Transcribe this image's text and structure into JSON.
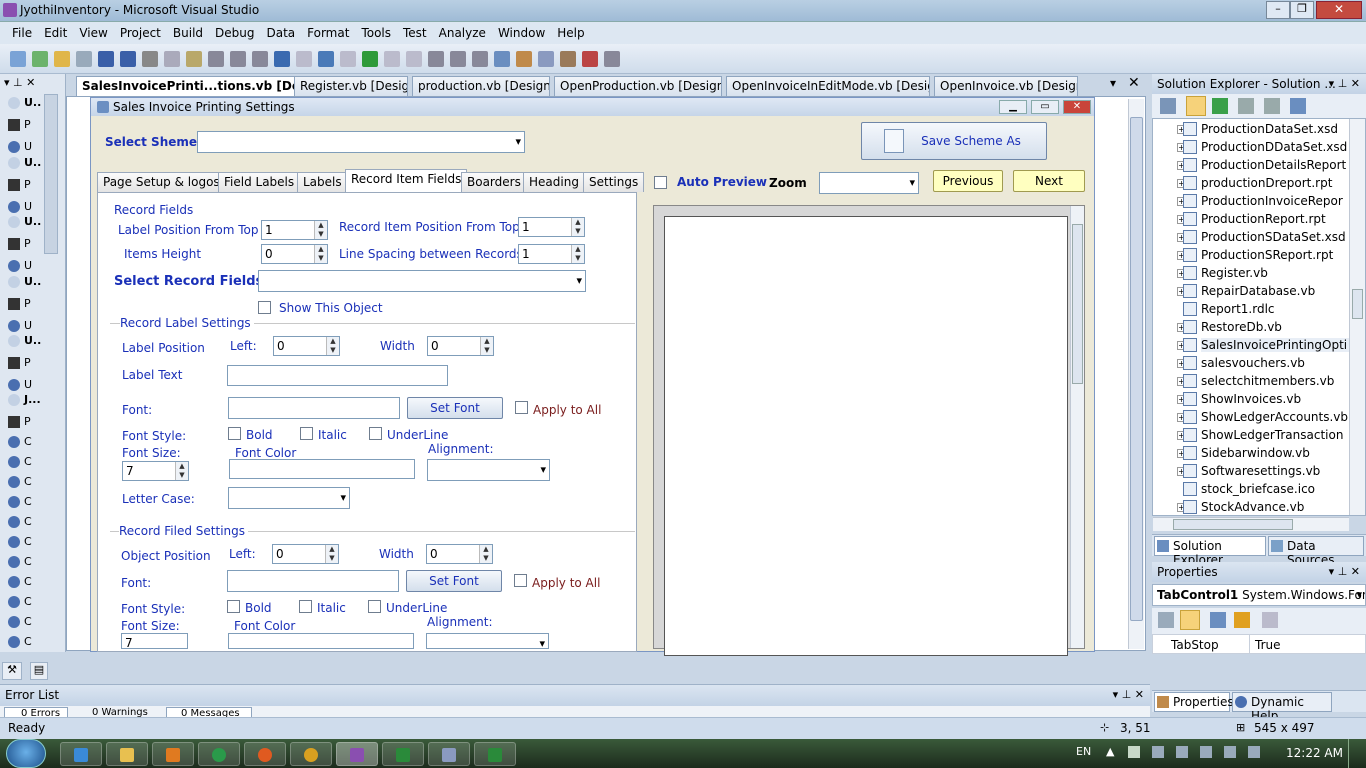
{
  "window": {
    "title": "JyothiInventory - Microsoft Visual Studio"
  },
  "menu": [
    "File",
    "Edit",
    "View",
    "Project",
    "Build",
    "Debug",
    "Data",
    "Format",
    "Tools",
    "Test",
    "Analyze",
    "Window",
    "Help"
  ],
  "doc_tabs": [
    {
      "label": "SalesInvoicePrinti...tions.vb [Design]*",
      "active": true
    },
    {
      "label": "Register.vb [Design]",
      "active": false
    },
    {
      "label": "production.vb [Design]*",
      "active": false
    },
    {
      "label": "OpenProduction.vb [Design]*",
      "active": false
    },
    {
      "label": "OpenInvoiceInEditMode.vb [Design]",
      "active": false
    },
    {
      "label": "OpenInvoice.vb [Design]*",
      "active": false
    }
  ],
  "form": {
    "title": "Sales Invoice Printing Settings",
    "select_scheme_label": "Select Sheme:",
    "save_scheme_button": "Save Scheme As",
    "auto_preview": "Auto Preview",
    "zoom_label": "Zoom",
    "previous_button": "Previous",
    "next_button": "Next",
    "tabs": [
      "Page Setup & logos",
      "Field Labels",
      "Labels",
      "Record Item Fields",
      "Boarders",
      "Heading",
      "Settings"
    ],
    "record_fields_header": "Record Fields",
    "label_pos_top": "Label Position From Top",
    "label_pos_top_value": "1",
    "record_pos_top": "Record Item Position From Top",
    "record_pos_top_value": "1",
    "items_height": "Items Height",
    "items_height_value": "0",
    "line_spacing": "Line Spacing between Records",
    "line_spacing_value": "1",
    "select_record_fields": "Select Record Fields",
    "show_object": "Show This Object",
    "record_label_settings": "Record Label Settings",
    "label_position": "Label Position",
    "left": "Left:",
    "left_value": "0",
    "width": "Width",
    "width_value": "0",
    "label_text": "Label Text",
    "font": "Font:",
    "set_font": "Set Font",
    "apply_all": "Apply to All",
    "font_style": "Font Style:",
    "bold": "Bold",
    "italic": "Italic",
    "underline": "UnderLine",
    "font_size": "Font Size:",
    "font_size_value": "7",
    "font_color": "Font Color",
    "alignment": "Alignment:",
    "letter_case": "Letter Case:",
    "record_filed_settings": "Record Filed Settings",
    "object_position": "Object Position",
    "font_size_value2": "7"
  },
  "solution_explorer": {
    "title": "Solution Explorer - Solution ...",
    "items": [
      "ProductionDataSet.xsd",
      "ProductionDDataSet.xsd",
      "ProductionDetailsReport",
      "productionDreport.rpt",
      "ProductionInvoiceRepor",
      "ProductionReport.rpt",
      "ProductionSDataSet.xsd",
      "ProductionSReport.rpt",
      "Register.vb",
      "RepairDatabase.vb",
      "Report1.rdlc",
      "RestoreDb.vb",
      "SalesInvoicePrintingOpti",
      "salesvouchers.vb",
      "selectchitmembers.vb",
      "ShowInvoices.vb",
      "ShowLedgerAccounts.vb",
      "ShowLedgerTransaction",
      "Sidebarwindow.vb",
      "Softwaresettings.vb",
      "stock_briefcase.ico",
      "StockAdvance.vb"
    ],
    "tabs": [
      "Solution Explorer",
      "Data Sources"
    ]
  },
  "properties": {
    "title": "Properties",
    "object": "TabControl1",
    "object_type": "System.Windows.Form",
    "rows": [
      {
        "name": "TabStop",
        "value": "True"
      }
    ],
    "tabs": [
      "Properties",
      "Dynamic Help"
    ]
  },
  "error_list": {
    "title": "Error List",
    "errors": "0 Errors",
    "warnings": "0 Warnings",
    "messages": "0 Messages"
  },
  "status": {
    "ready": "Ready",
    "position": "3, 51",
    "size": "545 x 497"
  },
  "taskbar": {
    "lang": "EN",
    "time": "12:22 AM"
  },
  "sidebar_labels": [
    "U..",
    "P",
    "U",
    "U..",
    "P",
    "U",
    "U..",
    "P",
    "U",
    "U..",
    "P",
    "U",
    "U..",
    "P",
    "U",
    "J...",
    "P",
    "C",
    "C",
    "C",
    "C",
    "C",
    "C",
    "C",
    "C",
    "C",
    "C",
    "C",
    "C"
  ]
}
